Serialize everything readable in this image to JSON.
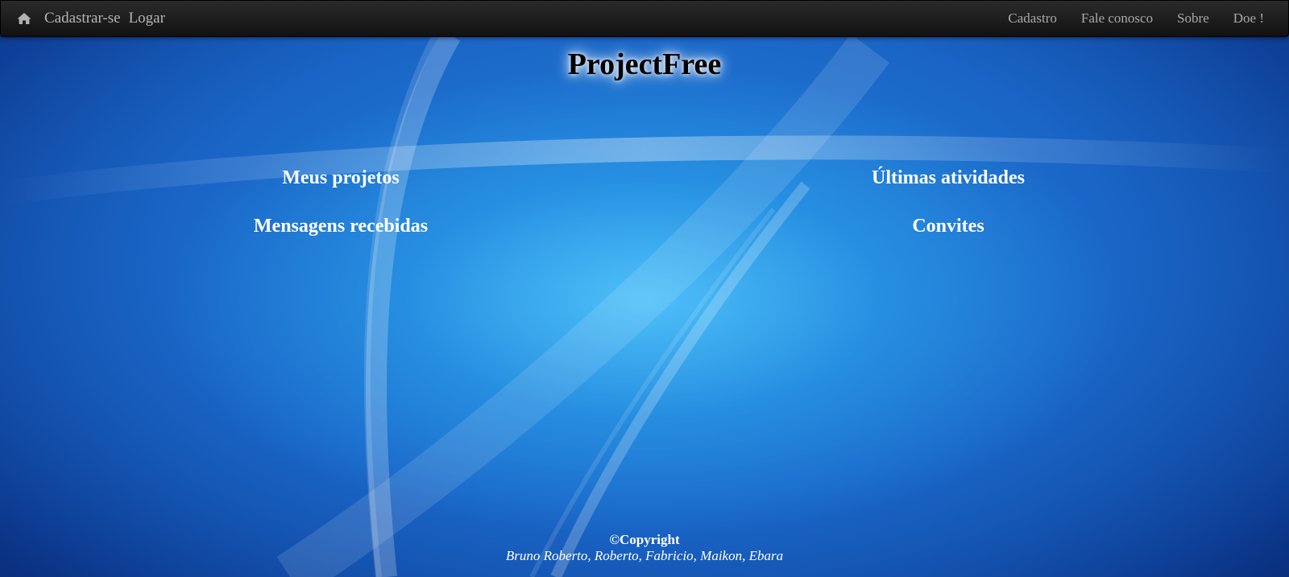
{
  "navbar": {
    "home_icon": "home-icon",
    "left_links": [
      "Cadastrar-se",
      "Logar"
    ],
    "right_links": [
      "Cadastro",
      "Fale conosco",
      "Sobre",
      "Doe !"
    ]
  },
  "page": {
    "title": "ProjectFree"
  },
  "sections": {
    "left": [
      "Meus projetos",
      "Mensagens recebidas"
    ],
    "right": [
      "Últimas atividades",
      "Convites"
    ]
  },
  "footer": {
    "copyright": "©Copyright",
    "authors": "Bruno Roberto, Roberto, Fabricio, Maikon, Ebara"
  },
  "colors": {
    "navbar": "#1a1a1a",
    "background": "#1565c0",
    "text": "#ffffff"
  }
}
